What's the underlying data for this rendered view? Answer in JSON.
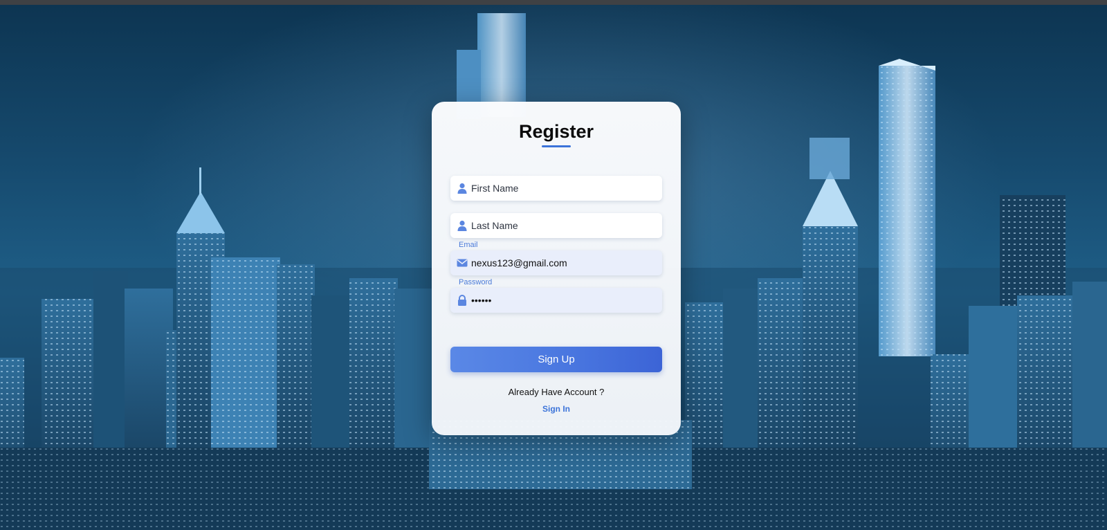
{
  "form": {
    "title": "Register",
    "first_name": {
      "placeholder": "First Name",
      "value": ""
    },
    "last_name": {
      "placeholder": "Last Name",
      "value": ""
    },
    "email": {
      "label": "Email",
      "value": "nexus123@gmail.com",
      "icon": "envelope-icon"
    },
    "password": {
      "label": "Password",
      "value": "••••••",
      "icon": "lock-icon"
    },
    "signup_label": "Sign Up",
    "already_text": "Already Have Account ?",
    "signin_label": "Sign In"
  },
  "colors": {
    "accent": "#3b73d9",
    "button_start": "#5a88e6",
    "button_end": "#3c64d6",
    "filled_field": "#e9eefb",
    "background": "#1f5f88"
  },
  "background": {
    "image": "night city skyline"
  }
}
